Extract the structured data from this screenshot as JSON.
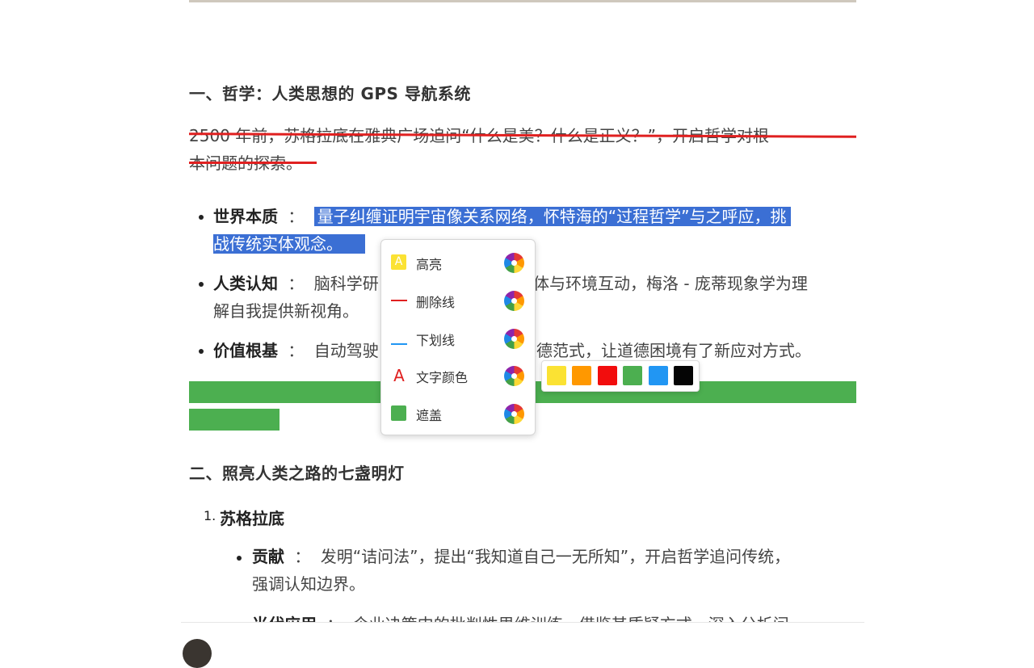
{
  "article": {
    "section1_title": "一、哲学：人类思想的 GPS 导航系统",
    "intro_line1": "2500 年前，苏格拉底在雅典广场追问“什么是美？什么是正义？”，开启哲学对根",
    "intro_line2": "本问题的探索。",
    "bullets": [
      {
        "term": "世界本质",
        "sep": "：",
        "selected_line1": "量子纠缠证明宇宙像关系网络，怀特海的“过程哲学”与之呼应，挑",
        "selected_line2": "战传统实体观念。"
      },
      {
        "term": "人类认知",
        "sep": "：",
        "text_a": "脑科学研",
        "text_b": "身体与环境互动，梅洛 - 庞蒂现象学为理",
        "line2": "解自我提供新视角。"
      },
      {
        "term": "价值根基",
        "sep": "：",
        "text_a": "自动驾驶",
        "text_b": "道德范式，让道德困境有了新应对方式。"
      }
    ],
    "section2_title": "二、照亮人类之路的七盏明灯",
    "list_number": "1.",
    "list_title": "苏格拉底",
    "sub_bullets": [
      {
        "term": "贡献",
        "sep": "：",
        "line1": "发明“诘问法”，提出“我知道自己一无所知”，开启哲学追问传统，",
        "line2": "强调认知边界。"
      },
      {
        "term": "当代应用",
        "sep": "：",
        "line1": "企业决策中的批判性思维训练，借鉴其质疑方式，深入分析问"
      }
    ]
  },
  "menu": {
    "items": [
      {
        "label": "高亮",
        "icon": "highlight-icon",
        "icon_text": "A"
      },
      {
        "label": "删除线",
        "icon": "strikethrough-icon"
      },
      {
        "label": "下划线",
        "icon": "underline-icon"
      },
      {
        "label": "文字颜色",
        "icon": "text-color-icon",
        "icon_text": "A"
      },
      {
        "label": "遮盖",
        "icon": "mask-icon"
      }
    ]
  },
  "palette": {
    "colors": [
      "#fbe233",
      "#ff9800",
      "#f20d0d",
      "#4caf50",
      "#2196f3",
      "#050505"
    ]
  },
  "colors": {
    "selection": "#3b6fd4",
    "strike": "#e02020",
    "mask_green": "#4caf50"
  }
}
